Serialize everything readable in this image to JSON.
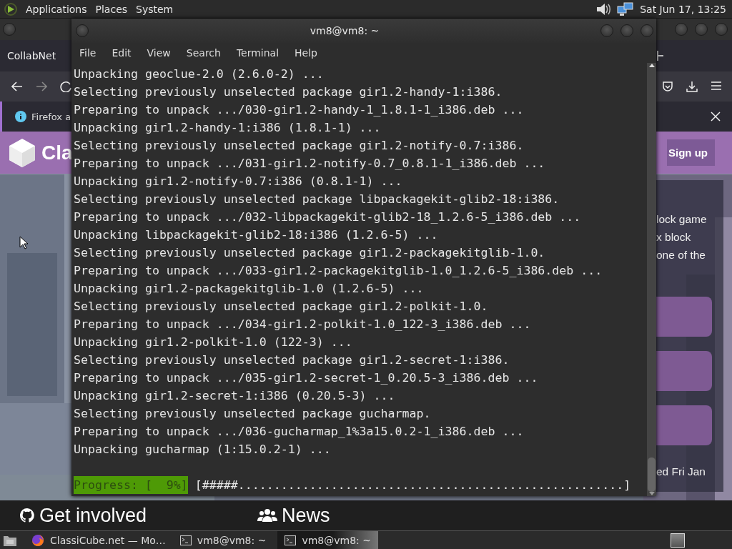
{
  "top_panel": {
    "menus": [
      "Applications",
      "Places",
      "System"
    ],
    "clock": "Sat Jun 17, 13:25"
  },
  "browser": {
    "tab": "CollabNet",
    "notification": "Firefox a",
    "site": {
      "logo_text": "Cla",
      "signup": "Sign up",
      "intro_lines": [
        "lock game",
        "x block",
        "one of the"
      ],
      "footer_note": "ed Fri Jan",
      "footer_links": [
        {
          "label": "Get involved",
          "kind": "github"
        },
        {
          "label": "News",
          "kind": "people"
        }
      ]
    }
  },
  "terminal": {
    "title": "vm8@vm8: ~",
    "menus": [
      "File",
      "Edit",
      "View",
      "Search",
      "Terminal",
      "Help"
    ],
    "lines": [
      "Unpacking geoclue-2.0 (2.6.0-2) ...",
      "Selecting previously unselected package gir1.2-handy-1:i386.",
      "Preparing to unpack .../030-gir1.2-handy-1_1.8.1-1_i386.deb ...",
      "Unpacking gir1.2-handy-1:i386 (1.8.1-1) ...",
      "Selecting previously unselected package gir1.2-notify-0.7:i386.",
      "Preparing to unpack .../031-gir1.2-notify-0.7_0.8.1-1_i386.deb ...",
      "Unpacking gir1.2-notify-0.7:i386 (0.8.1-1) ...",
      "Selecting previously unselected package libpackagekit-glib2-18:i386.",
      "Preparing to unpack .../032-libpackagekit-glib2-18_1.2.6-5_i386.deb ...",
      "Unpacking libpackagekit-glib2-18:i386 (1.2.6-5) ...",
      "Selecting previously unselected package gir1.2-packagekitglib-1.0.",
      "Preparing to unpack .../033-gir1.2-packagekitglib-1.0_1.2.6-5_i386.deb ...",
      "Unpacking gir1.2-packagekitglib-1.0 (1.2.6-5) ...",
      "Selecting previously unselected package gir1.2-polkit-1.0.",
      "Preparing to unpack .../034-gir1.2-polkit-1.0_122-3_i386.deb ...",
      "Unpacking gir1.2-polkit-1.0 (122-3) ...",
      "Selecting previously unselected package gir1.2-secret-1:i386.",
      "Preparing to unpack .../035-gir1.2-secret-1_0.20.5-3_i386.deb ...",
      "Unpacking gir1.2-secret-1:i386 (0.20.5-3) ...",
      "Selecting previously unselected package gucharmap.",
      "Preparing to unpack .../036-gucharmap_1%3a15.0.2-1_i386.deb ...",
      "Unpacking gucharmap (1:15.0.2-1) ..."
    ],
    "progress": {
      "label": "Progress: [  9%]",
      "bar": "[#####......................................................]"
    }
  },
  "taskbar": {
    "items": [
      {
        "label": "ClassiCube.net — Mo…",
        "kind": "browser",
        "selected": false
      },
      {
        "label": "vm8@vm8: ~",
        "kind": "terminal",
        "selected": false
      },
      {
        "label": "vm8@vm8: ~",
        "kind": "terminal",
        "selected": true
      }
    ]
  }
}
